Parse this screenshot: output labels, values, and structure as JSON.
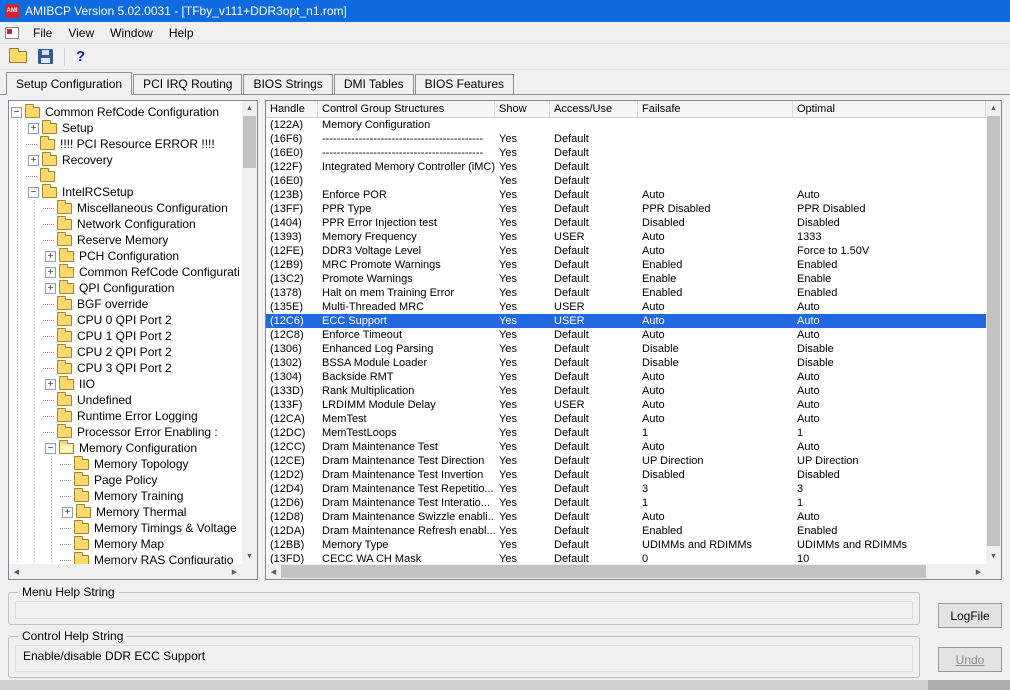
{
  "window": {
    "title": "AMIBCP Version 5.02.0031 - [TFby_v111+DDR3opt_n1.rom]"
  },
  "menubar": {
    "items": [
      "File",
      "View",
      "Window",
      "Help"
    ]
  },
  "icons": {
    "plus": "+",
    "minus": "−",
    "help": "?",
    "up": "▲",
    "down": "▼",
    "left": "◀",
    "right": "▶"
  },
  "tabs": [
    "Setup Configuration",
    "PCI IRQ Routing",
    "BIOS Strings",
    "DMI Tables",
    "BIOS Features"
  ],
  "active_tab": "Setup Configuration",
  "tree": {
    "items": [
      {
        "indent": 0,
        "expander": "minus",
        "icon": "folder",
        "label": "Common RefCode Configuration"
      },
      {
        "indent": 1,
        "expander": "plus",
        "icon": "folder",
        "label": "Setup"
      },
      {
        "indent": 1,
        "expander": "none",
        "icon": "folder",
        "label": "!!!! PCI Resource ERROR !!!!"
      },
      {
        "indent": 1,
        "expander": "plus",
        "icon": "folder",
        "label": "Recovery"
      },
      {
        "indent": 1,
        "expander": "none",
        "icon": "folder",
        "label": ""
      },
      {
        "indent": 1,
        "expander": "minus",
        "icon": "folder",
        "label": "IntelRCSetup"
      },
      {
        "indent": 2,
        "expander": "none",
        "icon": "folder",
        "label": "Miscellaneous Configuration"
      },
      {
        "indent": 2,
        "expander": "none",
        "icon": "folder",
        "label": "Network Configuration"
      },
      {
        "indent": 2,
        "expander": "none",
        "icon": "folder",
        "label": "Reserve Memory"
      },
      {
        "indent": 2,
        "expander": "plus",
        "icon": "folder",
        "label": "PCH Configuration"
      },
      {
        "indent": 2,
        "expander": "plus",
        "icon": "folder",
        "label": "Common RefCode Configurati"
      },
      {
        "indent": 2,
        "expander": "plus",
        "icon": "folder",
        "label": "QPI Configuration"
      },
      {
        "indent": 2,
        "expander": "none",
        "icon": "folder",
        "label": "BGF override"
      },
      {
        "indent": 2,
        "expander": "none",
        "icon": "folder",
        "label": "CPU 0 QPI Port 2"
      },
      {
        "indent": 2,
        "expander": "none",
        "icon": "folder",
        "label": "CPU 1 QPI Port 2"
      },
      {
        "indent": 2,
        "expander": "none",
        "icon": "folder",
        "label": "CPU 2 QPI Port 2"
      },
      {
        "indent": 2,
        "expander": "none",
        "icon": "folder",
        "label": "CPU 3 QPI Port 2"
      },
      {
        "indent": 2,
        "expander": "plus",
        "icon": "folder",
        "label": "IIO"
      },
      {
        "indent": 2,
        "expander": "none",
        "icon": "folder",
        "label": "Undefined"
      },
      {
        "indent": 2,
        "expander": "none",
        "icon": "folder",
        "label": "Runtime Error Logging"
      },
      {
        "indent": 2,
        "expander": "none",
        "icon": "folder",
        "label": "Processor Error Enabling :"
      },
      {
        "indent": 2,
        "expander": "minus",
        "icon": "folder-open",
        "label": "Memory Configuration"
      },
      {
        "indent": 3,
        "expander": "none",
        "icon": "folder",
        "label": "Memory Topology"
      },
      {
        "indent": 3,
        "expander": "none",
        "icon": "folder",
        "label": "Page Policy"
      },
      {
        "indent": 3,
        "expander": "none",
        "icon": "folder",
        "label": "Memory Training"
      },
      {
        "indent": 3,
        "expander": "plus",
        "icon": "folder",
        "label": "Memory Thermal"
      },
      {
        "indent": 3,
        "expander": "none",
        "icon": "folder",
        "label": "Memory Timings & Voltage"
      },
      {
        "indent": 3,
        "expander": "none",
        "icon": "folder",
        "label": "Memory Map"
      },
      {
        "indent": 3,
        "expander": "none",
        "icon": "folder",
        "label": "Memory RAS Configuratio"
      }
    ]
  },
  "table": {
    "columns": [
      "Handle",
      "Control Group Structures",
      "Show",
      "Access/Use",
      "Failsafe",
      "Optimal"
    ],
    "selected_row_index": 14,
    "rows": [
      [
        "(122A)",
        "Memory Configuration",
        "",
        "",
        "",
        ""
      ],
      [
        "(16F6)",
        "--------------------------------------------",
        "Yes",
        "Default",
        "",
        ""
      ],
      [
        "(16E0)",
        "--------------------------------------------",
        "Yes",
        "Default",
        "",
        ""
      ],
      [
        "(122F)",
        "Integrated Memory Controller (iMC)",
        "Yes",
        "Default",
        "",
        ""
      ],
      [
        "(16E0)",
        "",
        "Yes",
        "Default",
        "",
        ""
      ],
      [
        "(123B)",
        "Enforce POR",
        "Yes",
        "Default",
        "Auto",
        "Auto"
      ],
      [
        "(13FF)",
        "PPR Type",
        "Yes",
        "Default",
        "PPR Disabled",
        "PPR Disabled"
      ],
      [
        "(1404)",
        "PPR Error Injection test",
        "Yes",
        "Default",
        "Disabled",
        "Disabled"
      ],
      [
        "(1393)",
        "Memory Frequency",
        "Yes",
        "USER",
        "Auto",
        "1333"
      ],
      [
        "(12FE)",
        "DDR3 Voltage Level",
        "Yes",
        "Default",
        "Auto",
        "Force to 1.50V"
      ],
      [
        "(12B9)",
        "MRC Promote Warnings",
        "Yes",
        "Default",
        "Enabled",
        "Enabled"
      ],
      [
        "(13C2)",
        "Promote Warnings",
        "Yes",
        "Default",
        "Enable",
        "Enable"
      ],
      [
        "(1378)",
        "Halt on mem Training Error",
        "Yes",
        "Default",
        "Enabled",
        "Enabled"
      ],
      [
        "(135E)",
        "Multi-Threaded MRC",
        "Yes",
        "USER",
        "Auto",
        "Auto"
      ],
      [
        "(12C6)",
        "ECC Support",
        "Yes",
        "USER",
        "Auto",
        "Auto"
      ],
      [
        "(12C8)",
        "Enforce Timeout",
        "Yes",
        "Default",
        "Auto",
        "Auto"
      ],
      [
        "(1306)",
        "Enhanced Log Parsing",
        "Yes",
        "Default",
        "Disable",
        "Disable"
      ],
      [
        "(1302)",
        "BSSA Module Loader",
        "Yes",
        "Default",
        "Disable",
        "Disable"
      ],
      [
        "(1304)",
        "Backside RMT",
        "Yes",
        "Default",
        "Auto",
        "Auto"
      ],
      [
        "(133D)",
        "Rank Multiplication",
        "Yes",
        "Default",
        "Auto",
        "Auto"
      ],
      [
        "(133F)",
        "LRDIMM Module Delay",
        "Yes",
        "USER",
        "Auto",
        "Auto"
      ],
      [
        "(12CA)",
        "MemTest",
        "Yes",
        "Default",
        "Auto",
        "Auto"
      ],
      [
        "(12DC)",
        "MemTestLoops",
        "Yes",
        "Default",
        "1",
        "1"
      ],
      [
        "(12CC)",
        "Dram Maintenance Test",
        "Yes",
        "Default",
        "Auto",
        "Auto"
      ],
      [
        "(12CE)",
        "Dram Maintenance Test Direction",
        "Yes",
        "Default",
        "UP Direction",
        "UP Direction"
      ],
      [
        "(12D2)",
        "Dram Maintenance Test Invertion",
        "Yes",
        "Default",
        "Disabled",
        "Disabled"
      ],
      [
        "(12D4)",
        "Dram Maintenance Test Repetitio...",
        "Yes",
        "Default",
        "3",
        "3"
      ],
      [
        "(12D6)",
        "Dram Maintenance Test Interatio...",
        "Yes",
        "Default",
        "1",
        "1"
      ],
      [
        "(12D8)",
        "Dram Maintenance Swizzle enabli...",
        "Yes",
        "Default",
        "Auto",
        "Auto"
      ],
      [
        "(12DA)",
        "Dram Maintenance Refresh enabl...",
        "Yes",
        "Default",
        "Enabled",
        "Enabled"
      ],
      [
        "(12BB)",
        "Memory Type",
        "Yes",
        "Default",
        "UDIMMs and RDIMMs",
        "UDIMMs and RDIMMs"
      ],
      [
        "(13FD)",
        "CECC WA CH Mask",
        "Yes",
        "Default",
        "0",
        "10"
      ]
    ]
  },
  "help_panels": {
    "menu_help_label": "Menu Help String",
    "menu_help_text": "",
    "control_help_label": "Control Help String",
    "control_help_text": "Enable/disable DDR ECC Support"
  },
  "buttons": {
    "logfile": "LogFile",
    "undo": "Undo"
  },
  "colors": {
    "titlebar": "#0d6bdf",
    "selection": "#2268e0",
    "folder": "#ffd86b"
  }
}
